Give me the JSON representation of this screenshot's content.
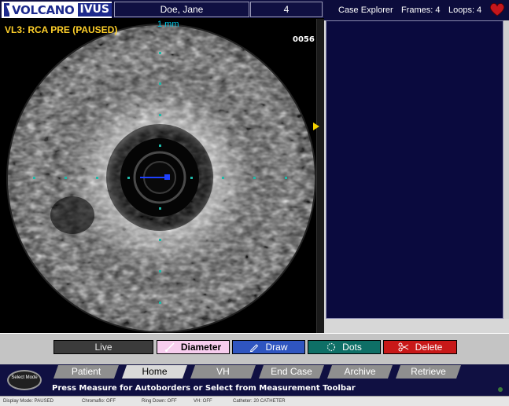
{
  "header": {
    "brand": "VOLCANO",
    "product": "IVUS",
    "patient_name": "Doe, Jane",
    "frame_number": "4"
  },
  "viewport": {
    "title": "VL3: RCA PRE (PAUSED)",
    "scale_label": "1 mm",
    "frame_counter": "0056",
    "title_color": "#ffd02a"
  },
  "explorer": {
    "title": "Case Explorer",
    "frames_label": "Frames:",
    "frames_value": "4",
    "loops_label": "Loops:",
    "loops_value": "4",
    "icon": "heart-icon"
  },
  "toolbar": {
    "live": "Live",
    "diameter": "Diameter",
    "draw": "Draw",
    "dots": "Dots",
    "delete": "Delete",
    "colors": {
      "diameter": "#f7cdee",
      "draw": "#2f55c0",
      "dots": "#0e6f66",
      "delete": "#c81818"
    }
  },
  "nav": {
    "select_mode": "Select Mode",
    "tabs": [
      "Patient",
      "Home",
      "VH",
      "End Case",
      "Archive",
      "Retrieve"
    ],
    "active_tab": "Home",
    "status_message": "Press Measure for Autoborders or Select from Measurement Toolbar"
  },
  "status_bar": [
    "Display Mode: PAUSED",
    "Chromaflo: OFF",
    "Ring Down: OFF",
    "VH: OFF",
    "Catheter: 20 CATHETER"
  ]
}
